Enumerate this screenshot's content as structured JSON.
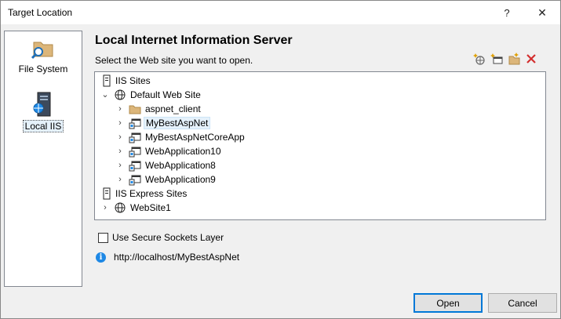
{
  "window": {
    "title": "Target Location",
    "help_glyph": "?",
    "close_glyph": "✕"
  },
  "nav": {
    "items": [
      {
        "label": "File System",
        "icon": "folder-search-icon"
      },
      {
        "label": "Local IIS",
        "icon": "server-icon",
        "selected": true
      }
    ]
  },
  "main": {
    "heading": "Local Internet Information Server",
    "prompt": "Select the Web site you want to open.",
    "toolbar": [
      "create-application-icon",
      "create-virtual-directory-icon",
      "new-folder-icon",
      "delete-icon"
    ]
  },
  "tree": {
    "rows": [
      {
        "label": "IIS Sites",
        "icon": "server-icon",
        "expander": ""
      },
      {
        "label": "Default Web Site",
        "icon": "globe-icon",
        "expander": "⌄"
      },
      {
        "label": "aspnet_client",
        "icon": "folder-icon",
        "expander": "›"
      },
      {
        "label": "MyBestAspNet",
        "icon": "web-app-icon",
        "expander": "›",
        "selected": true
      },
      {
        "label": "MyBestAspNetCoreApp",
        "icon": "web-app-icon",
        "expander": "›"
      },
      {
        "label": "WebApplication10",
        "icon": "web-app-icon",
        "expander": "›"
      },
      {
        "label": "WebApplication8",
        "icon": "web-app-icon",
        "expander": "›"
      },
      {
        "label": "WebApplication9",
        "icon": "web-app-icon",
        "expander": "›"
      },
      {
        "label": "IIS Express Sites",
        "icon": "server-icon",
        "expander": ""
      },
      {
        "label": "WebSite1",
        "icon": "globe-icon",
        "expander": "›"
      }
    ]
  },
  "options": {
    "ssl_label": "Use Secure Sockets Layer",
    "ssl_checked": false,
    "url": "http://localhost/MyBestAspNet"
  },
  "buttons": {
    "open": "Open",
    "cancel": "Cancel"
  },
  "colors": {
    "accent": "#0078d7",
    "selection": "#e5f1fb",
    "delete": "#d32f2f",
    "folder": "#dcb67a"
  }
}
